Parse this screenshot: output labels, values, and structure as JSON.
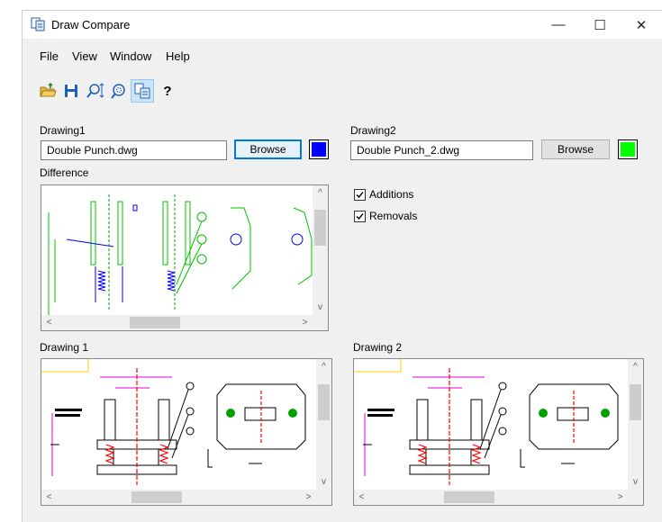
{
  "window": {
    "title": "Draw Compare",
    "minimize": "—",
    "maximize": "☐",
    "close": "✕"
  },
  "menu": {
    "items": [
      "File",
      "View",
      "Window",
      "Help"
    ]
  },
  "toolbar": {
    "buttons": [
      {
        "icon": "open-folder-icon"
      },
      {
        "icon": "save-icon"
      },
      {
        "icon": "zoom-extents-icon"
      },
      {
        "icon": "zoom-window-icon"
      },
      {
        "icon": "compare-icon",
        "active": true
      },
      {
        "icon": "help-icon",
        "label": "?"
      }
    ]
  },
  "drawing1": {
    "label": "Drawing1",
    "file": "Double Punch.dwg",
    "browse": "Browse",
    "color": "#0000ff"
  },
  "drawing2": {
    "label": "Drawing2",
    "file": "Double Punch_2.dwg",
    "browse": "Browse",
    "color": "#00ff00"
  },
  "difference": {
    "label": "Difference"
  },
  "options": {
    "additions": "Additions",
    "removals": "Removals",
    "additions_checked": true,
    "removals_checked": true
  },
  "view1": {
    "label": "Drawing 1"
  },
  "view2": {
    "label": "Drawing 2"
  },
  "scroll": {
    "up": "^",
    "down": "v",
    "left": "<",
    "right": ">"
  }
}
